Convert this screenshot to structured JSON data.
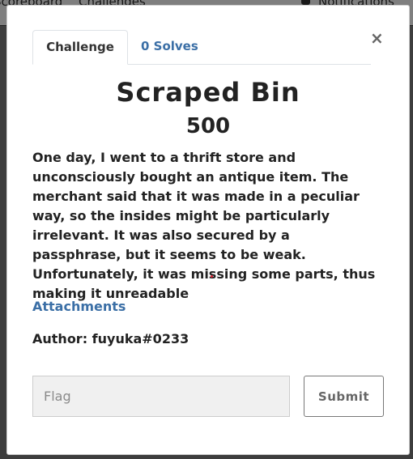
{
  "nav": {
    "links": [
      "Scoreboard",
      "Challenges"
    ],
    "notifications": "Notifications"
  },
  "modal": {
    "tabs": [
      {
        "label": "Challenge"
      },
      {
        "label": "0 Solves"
      }
    ],
    "close": "×",
    "title": "Scraped Bin",
    "value": "500",
    "description": "One day, I went to a thrift store and unconsciously bought an antique item. The merchant said that it was made in a peculiar way, so the insides might be particularly irrelevant. It was also secured by a passphrase, but it seems to be weak. Unfortunately, it was missing some parts, thus making it unreadable",
    "attachments": "Attachments",
    "author": "Author: fuyuka#0233",
    "flag_placeholder": "Flag",
    "submit": "Submit"
  },
  "colors": {
    "accent": "#3b6fa6",
    "text": "#222222"
  }
}
